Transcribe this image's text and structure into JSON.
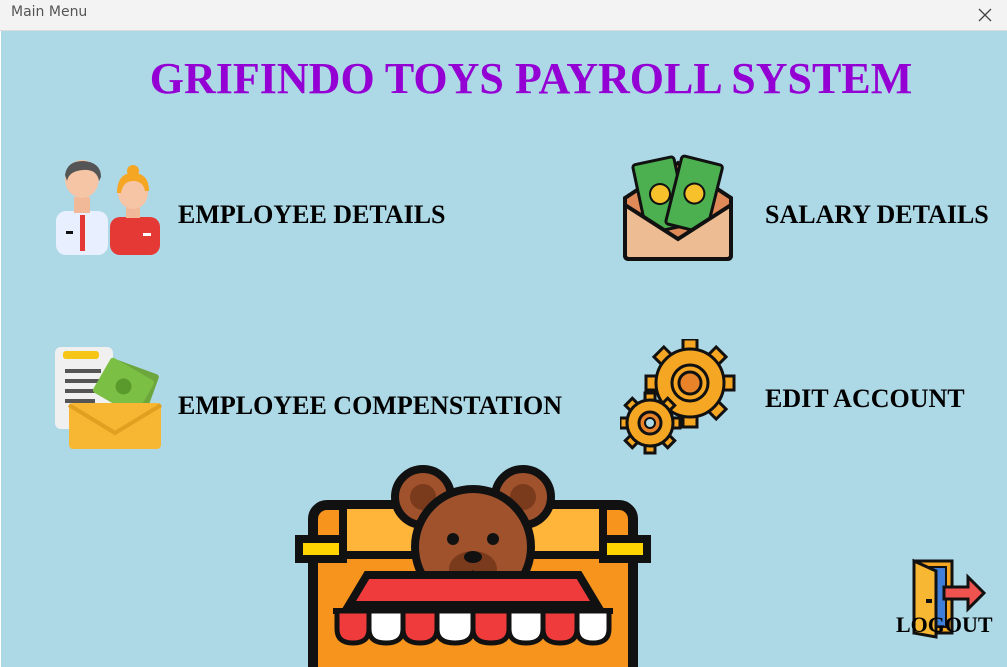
{
  "window": {
    "title": "Main Menu"
  },
  "heading": "GRIFINDO TOYS PAYROLL SYSTEM",
  "menu": {
    "employee_details": "EMPLOYEE DETAILS",
    "salary_details": "SALARY DETAILS",
    "employee_compensation": "EMPLOYEE COMPENSTATION",
    "edit_account": "EDIT ACCOUNT",
    "logout": "LOGOUT"
  },
  "colors": {
    "background": "#add8e6",
    "heading": "#9400d3",
    "titlebar": "#f3f3f3"
  },
  "icons": {
    "employee_details": "employees-icon",
    "salary_details": "money-envelope-icon",
    "employee_compensation": "compensation-document-icon",
    "edit_account": "gears-icon",
    "logo": "teddy-bear-toy-shop-icon",
    "logout": "exit-door-icon"
  }
}
